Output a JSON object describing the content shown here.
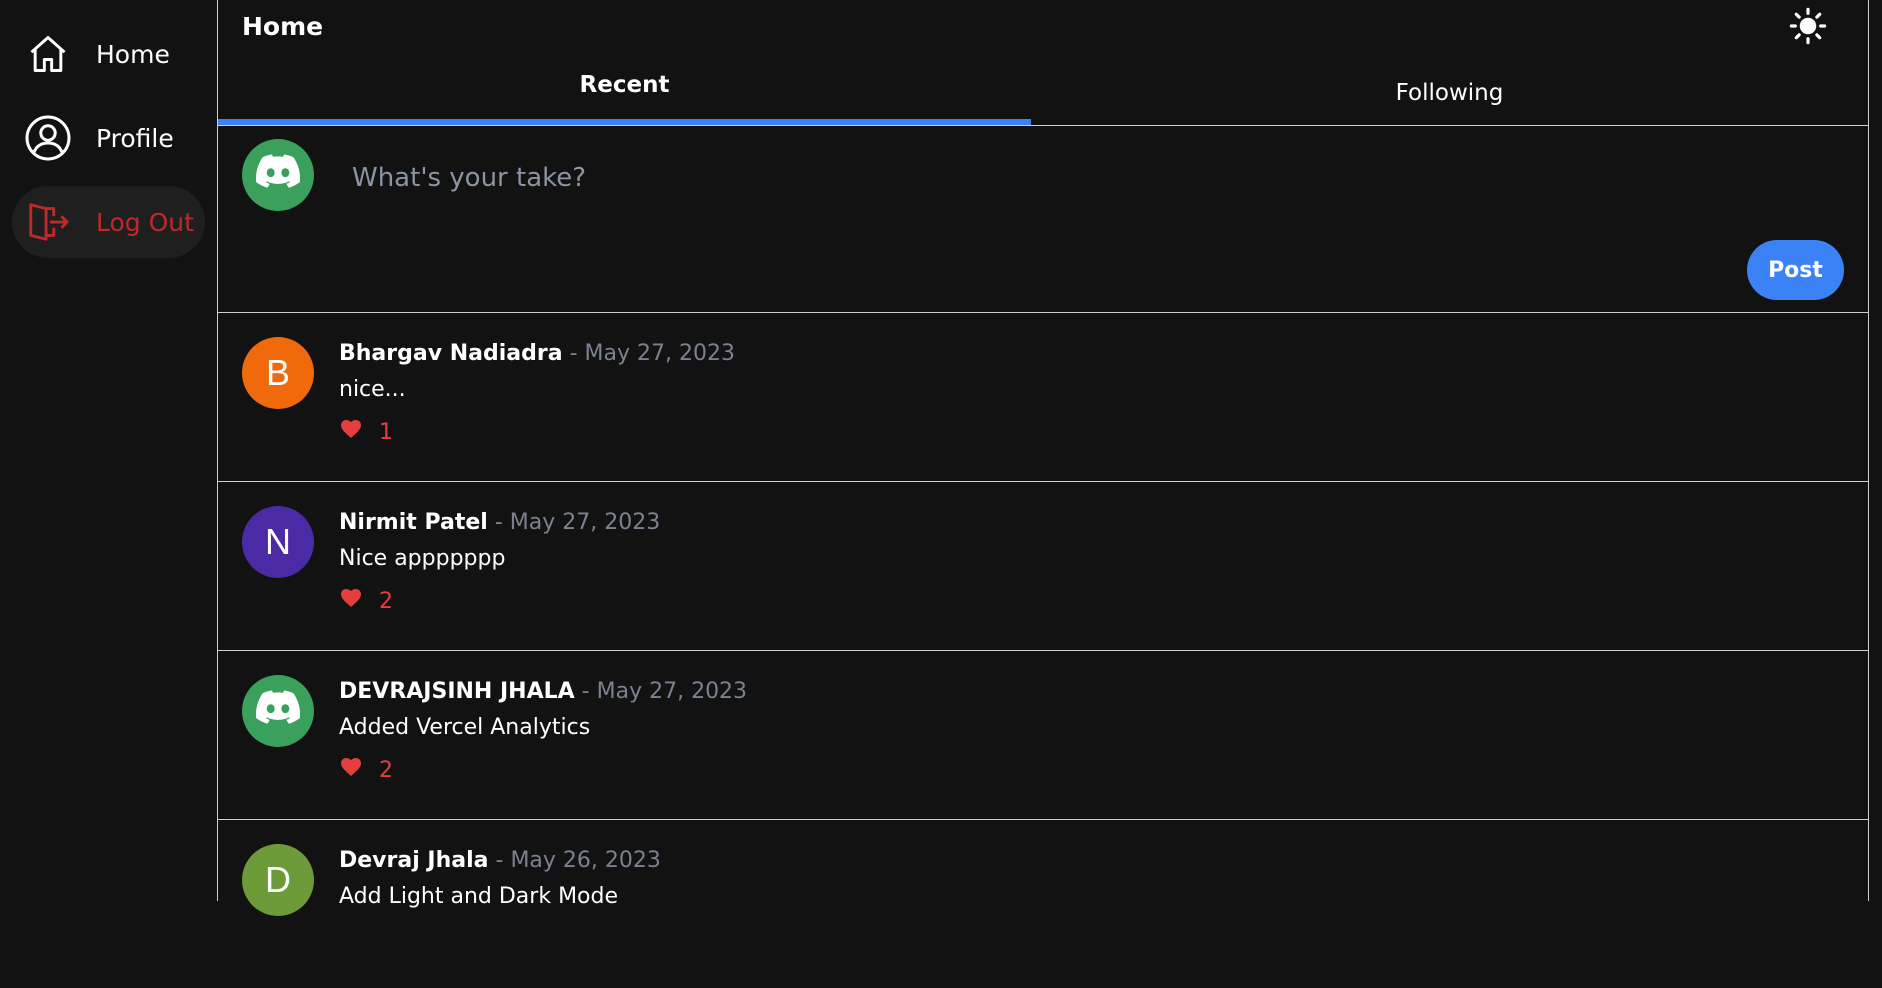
{
  "sidebar": {
    "items": [
      {
        "label": "Home",
        "icon": "home-icon"
      },
      {
        "label": "Profile",
        "icon": "user-circle-icon"
      },
      {
        "label": "Log Out",
        "icon": "logout-icon"
      }
    ]
  },
  "header": {
    "title": "Home",
    "theme_icon": "sun-icon"
  },
  "tabs": [
    {
      "label": "Recent",
      "active": true
    },
    {
      "label": "Following",
      "active": false
    }
  ],
  "composer": {
    "placeholder": "What's your take?",
    "post_label": "Post",
    "avatar_icon": "discord-icon",
    "avatar_color": "#3aa05b"
  },
  "posts": [
    {
      "author": "Bhargav Nadiadra",
      "separator": "-",
      "date": "May 27, 2023",
      "content": "nice...",
      "likes": "1",
      "avatar_letter": "B",
      "avatar_color": "#f06a0c"
    },
    {
      "author": "Nirmit Patel",
      "separator": "-",
      "date": "May 27, 2023",
      "content": "Nice appppppp",
      "likes": "2",
      "avatar_letter": "N",
      "avatar_color": "#4a2aa5"
    },
    {
      "author": "DEVRAJSINH JHALA",
      "separator": "-",
      "date": "May 27, 2023",
      "content": "Added Vercel Analytics",
      "likes": "2",
      "avatar_icon": "discord-icon",
      "avatar_color": "#3aa05b"
    },
    {
      "author": "Devraj Jhala",
      "separator": "-",
      "date": "May 26, 2023",
      "content": "Add Light and Dark Mode",
      "avatar_letter": "D",
      "avatar_color": "#6e9b3a"
    }
  ],
  "colors": {
    "accent": "#3b82f6",
    "danger": "#c0282a",
    "like": "#e53e3e",
    "background": "#121212"
  }
}
